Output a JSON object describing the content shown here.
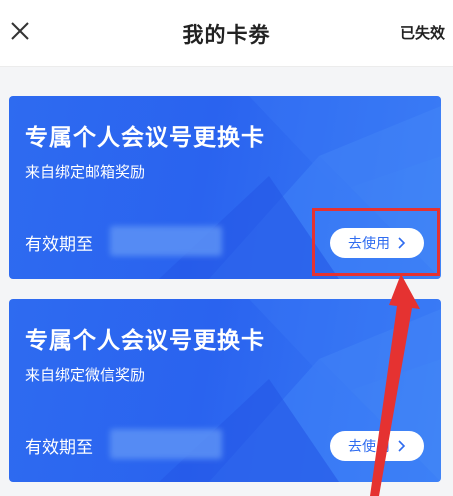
{
  "header": {
    "title": "我的卡劵",
    "expired_label": "已失效"
  },
  "cards": [
    {
      "title": "专属个人会议号更换卡",
      "source": "来自绑定邮箱奖励",
      "validity_label": "有效期至",
      "use_label": "去使用"
    },
    {
      "title": "专属个人会议号更换卡",
      "source": "来自绑定微信奖励",
      "validity_label": "有效期至",
      "use_label": "去使用"
    }
  ],
  "colors": {
    "card_blue": "#2e6bf0",
    "annotation_red": "#e53231"
  },
  "icons": {
    "close": "close-icon",
    "chevron": "chevron-right-icon"
  }
}
